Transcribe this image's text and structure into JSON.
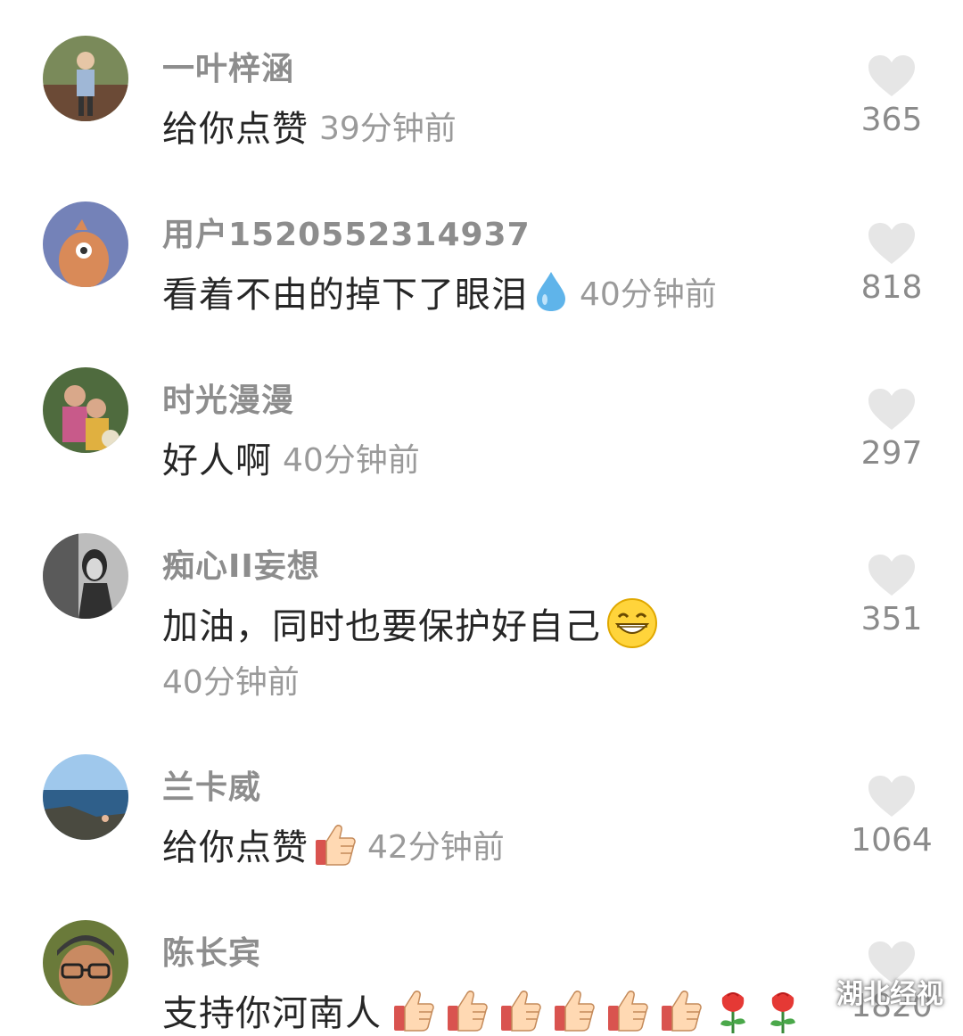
{
  "comments": [
    {
      "username": "一叶梓涵",
      "text": "给你点赞",
      "time": "39分钟前",
      "likes": "365",
      "emoji": []
    },
    {
      "username": "用户1520552314937",
      "text": "看着不由的掉下了眼泪",
      "time": "40分钟前",
      "likes": "818",
      "emoji": [
        "droplet-emoji"
      ]
    },
    {
      "username": "时光漫漫",
      "text": "好人啊",
      "time": "40分钟前",
      "likes": "297",
      "emoji": []
    },
    {
      "username": "痴心II妄想",
      "text": "加油，同时也要保护好自己",
      "time": "40分钟前",
      "likes": "351",
      "emoji": [
        "grin-emoji"
      ]
    },
    {
      "username": "兰卡威",
      "text": "给你点赞",
      "time": "42分钟前",
      "likes": "1064",
      "emoji": [
        "thumbs-up-emoji"
      ]
    },
    {
      "username": "陈长宾",
      "text": "支持你河南人",
      "time": "",
      "likes": "1820",
      "emoji": [
        "thumbs-up-emoji",
        "thumbs-up-emoji",
        "thumbs-up-emoji",
        "thumbs-up-emoji",
        "thumbs-up-emoji",
        "thumbs-up-emoji",
        "rose-emoji",
        "rose-emoji"
      ]
    }
  ],
  "icons": {
    "like": "heart-icon",
    "watermark": "wechat-icon"
  },
  "watermark": {
    "text": "湖北经视"
  },
  "colors": {
    "username": "#8d8d8d",
    "text": "#262626",
    "meta": "#9a9a9a",
    "heart": "#e6e6e6"
  }
}
